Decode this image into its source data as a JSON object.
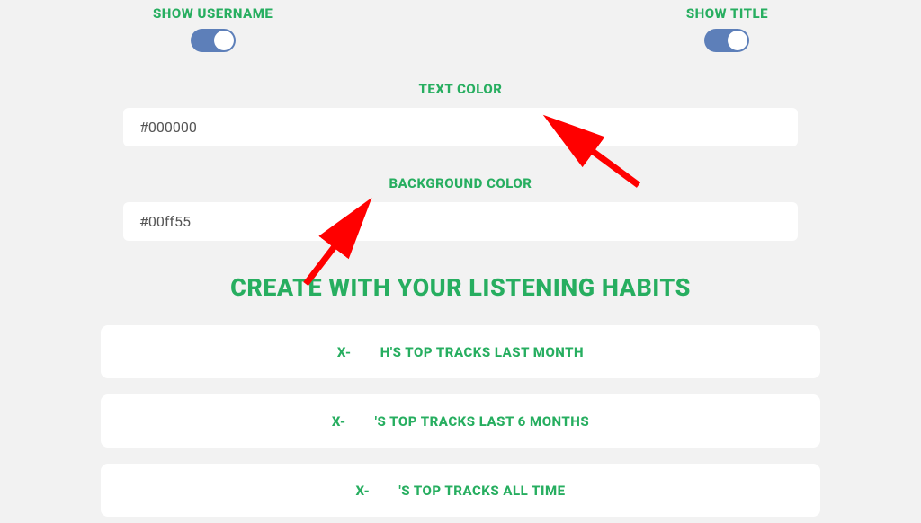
{
  "toggles": {
    "show_username_label": "SHOW USERNAME",
    "show_title_label": "SHOW TITLE",
    "show_username_on": true,
    "show_title_on": true
  },
  "text_color": {
    "label": "TEXT COLOR",
    "value": "#000000"
  },
  "background_color": {
    "label": "BACKGROUND COLOR",
    "value": "#00ff55"
  },
  "heading": "CREATE WITH YOUR LISTENING HABITS",
  "options": [
    {
      "prefix": "X-",
      "rest": "H'S TOP TRACKS LAST MONTH"
    },
    {
      "prefix": "X-",
      "rest": "'S TOP TRACKS LAST 6 MONTHS"
    },
    {
      "prefix": "X-",
      "rest": "'S TOP TRACKS ALL TIME"
    }
  ],
  "colors": {
    "accent": "#27ae60",
    "toggle_track": "#5d7fb9",
    "card_bg": "#ffffff",
    "page_bg": "#f2f2f2",
    "arrow": "#ff0000"
  }
}
